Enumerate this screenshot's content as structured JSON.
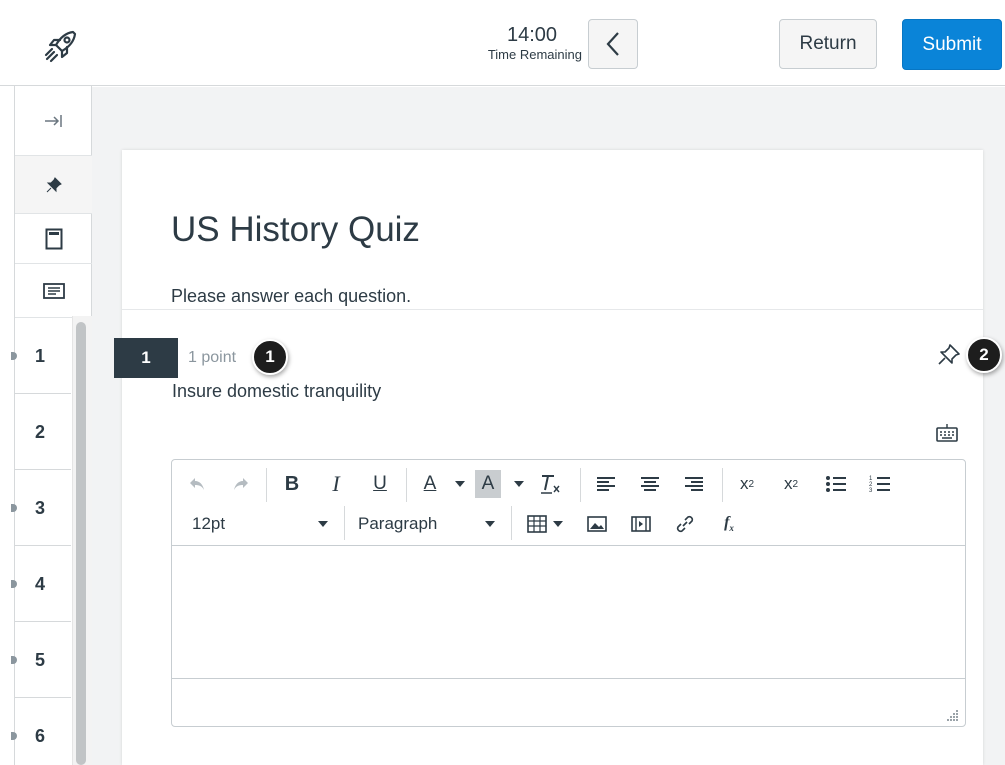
{
  "header": {
    "time": "14:00",
    "time_label": "Time Remaining",
    "return_label": "Return",
    "submit_label": "Submit"
  },
  "rail": {
    "questions": [
      "1",
      "2",
      "3",
      "4",
      "5",
      "6"
    ]
  },
  "quiz": {
    "title": "US History Quiz",
    "instructions": "Please answer each question."
  },
  "question": {
    "number": "1",
    "points": "1 point",
    "text": "Insure domestic tranquility"
  },
  "callouts": [
    "1",
    "2"
  ],
  "editor": {
    "font_size": "12pt",
    "block_format": "Paragraph"
  },
  "colors": {
    "submit": "#0a84d8",
    "question_badge": "#2d3b45",
    "callout": "#1d1d1d"
  }
}
